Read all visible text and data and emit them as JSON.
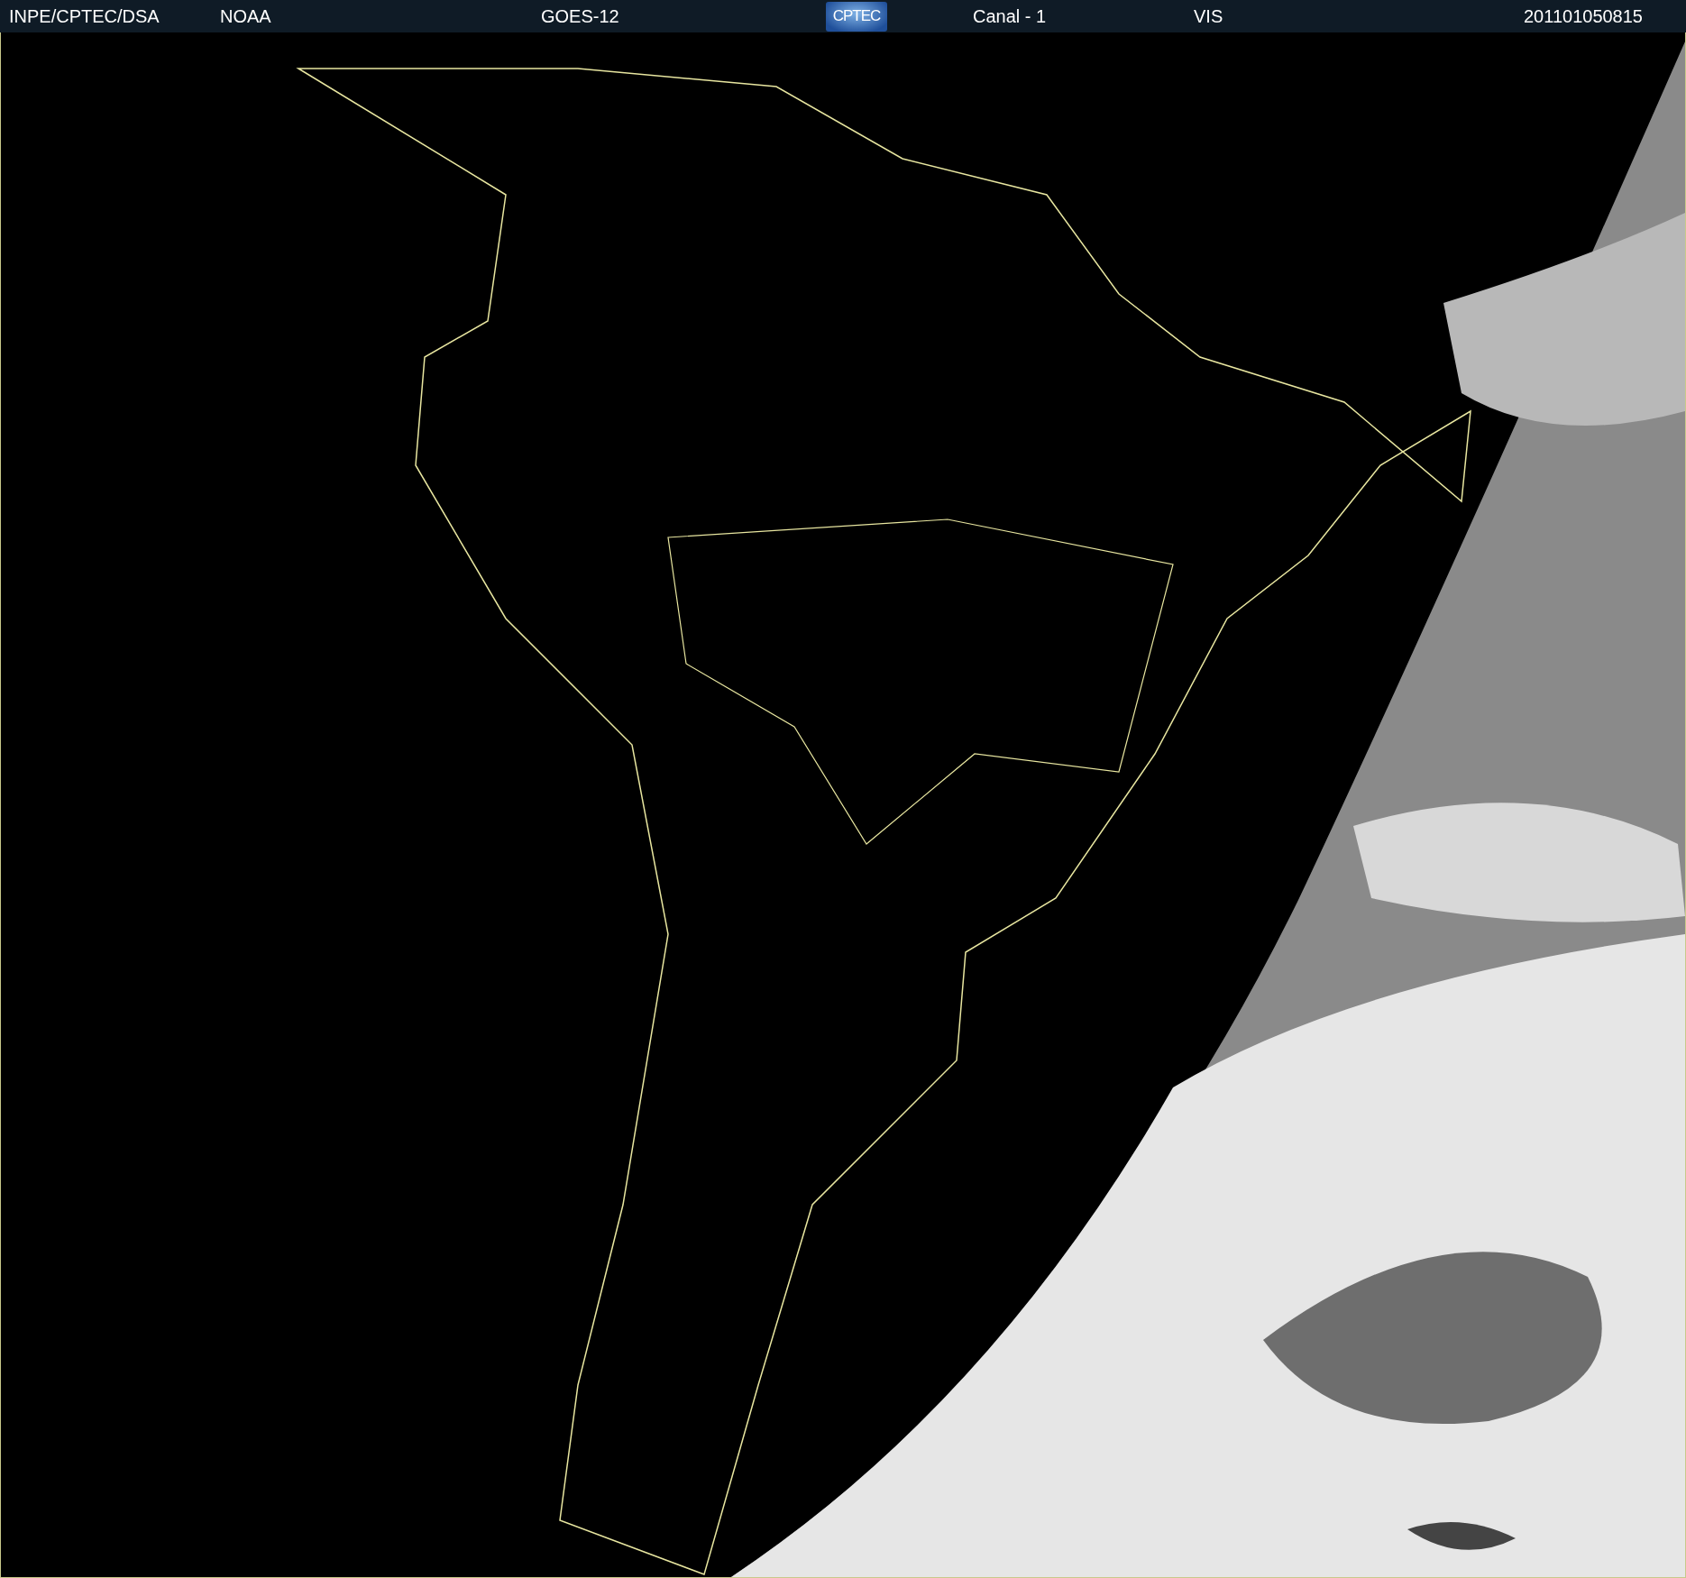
{
  "header": {
    "items": [
      {
        "kind": "text",
        "text": "INPE/CPTEC/DSA"
      },
      {
        "kind": "text",
        "text": "NOAA"
      },
      {
        "kind": "text",
        "text": "GOES-12"
      },
      {
        "kind": "logo",
        "text": "CPTEC"
      },
      {
        "kind": "text",
        "text": "Canal - 1"
      },
      {
        "kind": "text",
        "text": "VIS"
      },
      {
        "kind": "text",
        "text": "201101050815"
      }
    ]
  }
}
